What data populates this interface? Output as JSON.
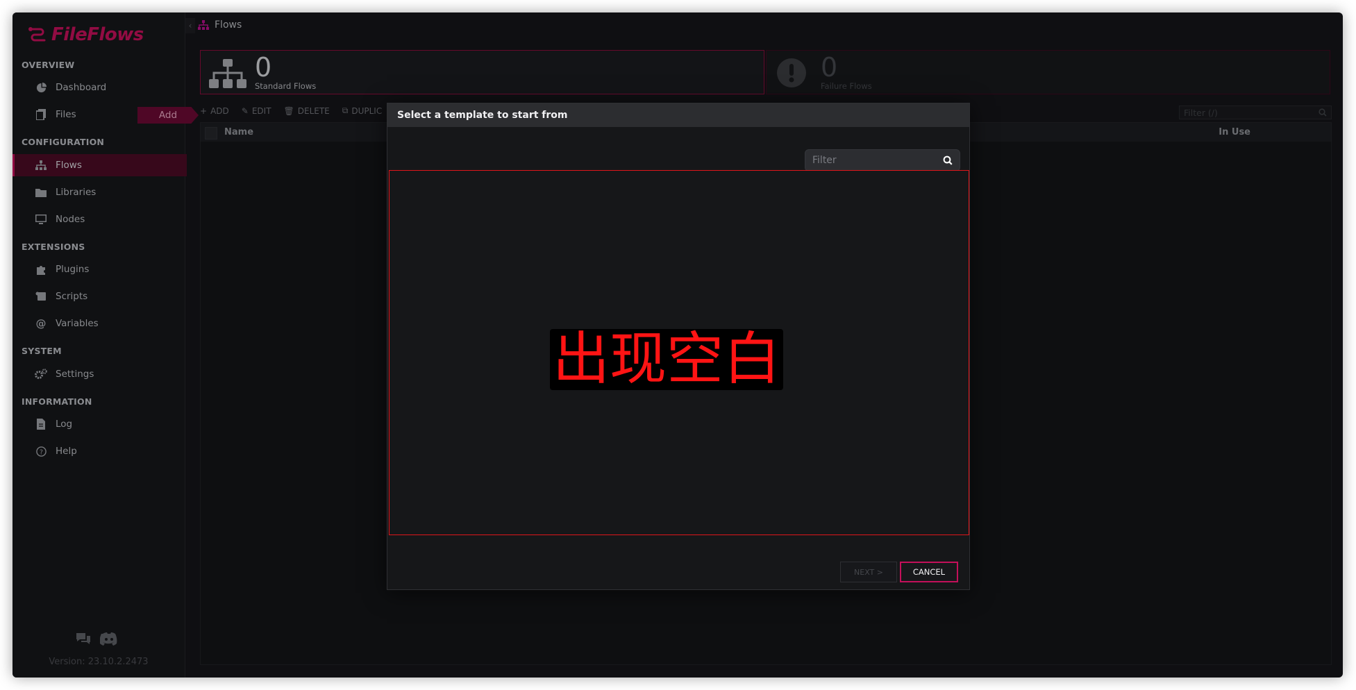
{
  "app": {
    "name": "FileFlows",
    "version": "Version: 23.10.2.2473"
  },
  "sidebar": {
    "sections": [
      {
        "title": "OVERVIEW"
      },
      {
        "title": "CONFIGURATION"
      },
      {
        "title": "EXTENSIONS"
      },
      {
        "title": "SYSTEM"
      },
      {
        "title": "INFORMATION"
      }
    ],
    "items": {
      "dashboard": "Dashboard",
      "files": "Files",
      "flows": "Flows",
      "libraries": "Libraries",
      "nodes": "Nodes",
      "plugins": "Plugins",
      "scripts": "Scripts",
      "variables": "Variables",
      "settings": "Settings",
      "log": "Log",
      "help": "Help"
    },
    "add_tab": "Add",
    "active": "flows"
  },
  "header": {
    "breadcrumb": "Flows"
  },
  "stats": {
    "standard": {
      "count": "0",
      "label": "Standard Flows"
    },
    "failure": {
      "count": "0",
      "label": "Failure Flows"
    }
  },
  "toolbar": {
    "add": "ADD",
    "edit": "EDIT",
    "delete": "DELETE",
    "duplicate": "DUPLIC"
  },
  "grid": {
    "filter_placeholder": "Filter (/)",
    "columns": {
      "name": "Name",
      "in_use": "In Use"
    }
  },
  "modal": {
    "title": "Select a template to start from",
    "filter_placeholder": "Filter",
    "annotation": "出现空白",
    "next_label": "NEXT >",
    "cancel_label": "CANCEL"
  },
  "colors": {
    "accent": "#c3105a",
    "annotation": "#ff1414"
  }
}
